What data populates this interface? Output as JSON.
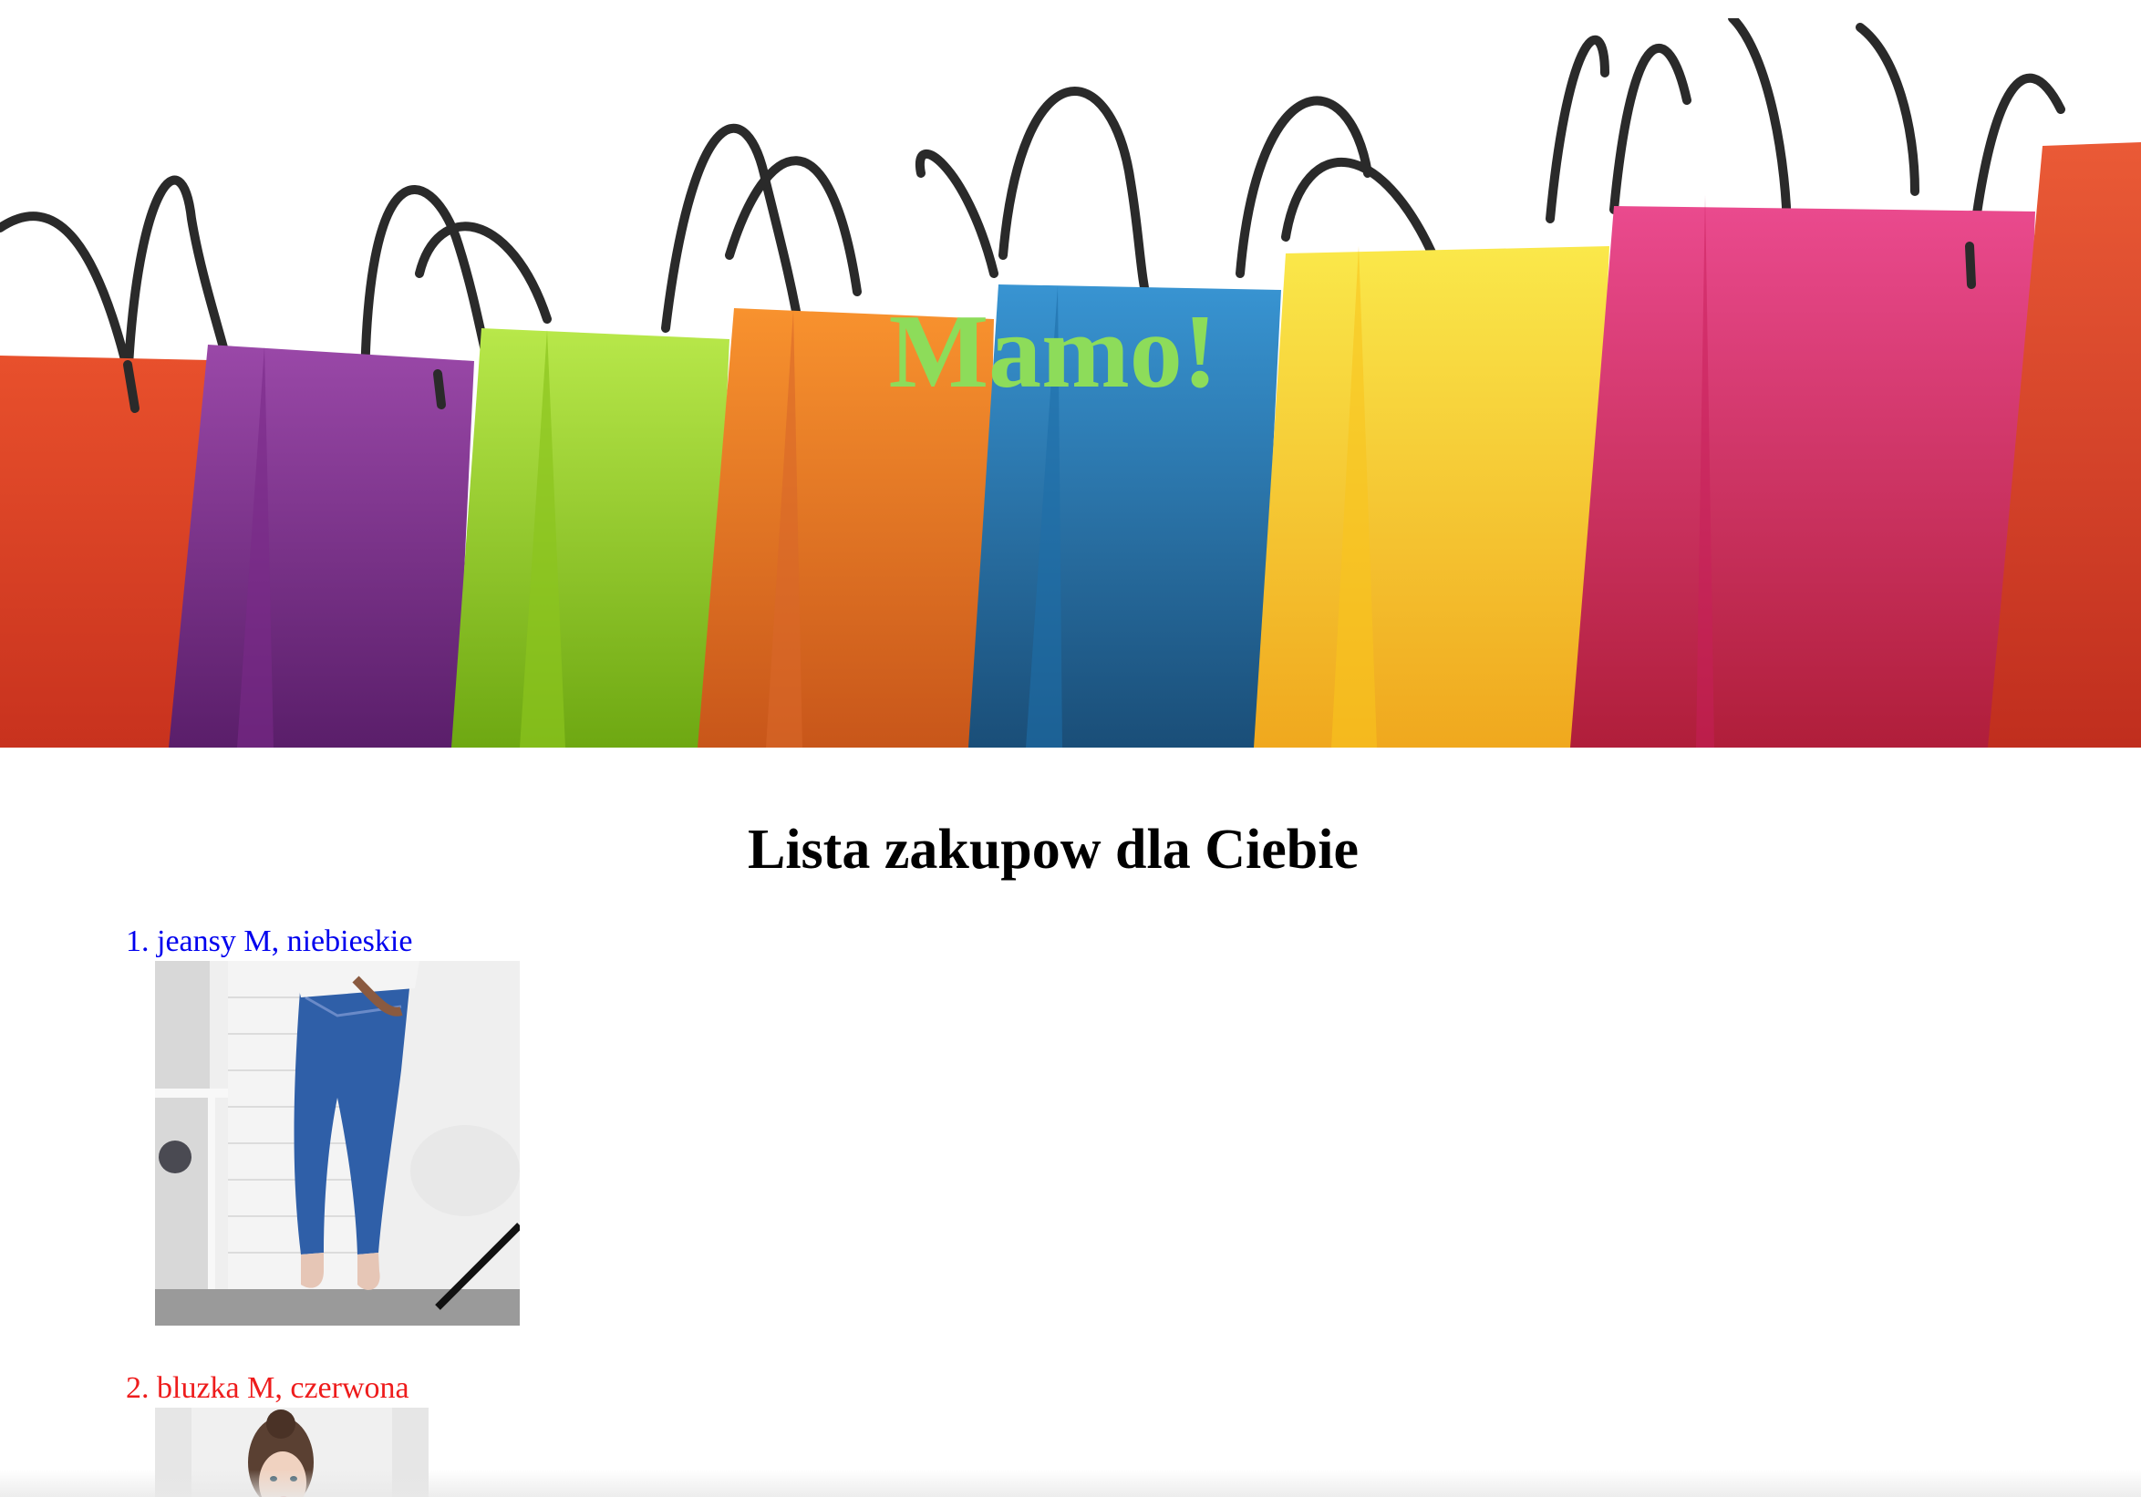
{
  "banner": {
    "title": "Mamo!",
    "title_color": "#8ddc5a",
    "image": "shopping-bags-image",
    "bag_colors": [
      "#e84a2a",
      "#8e3aa0",
      "#a5dc2e",
      "#f0862a",
      "#2f8ac8",
      "#f5d21e",
      "#e63c78",
      "#e65a36"
    ]
  },
  "heading": "Lista zakupow dla Ciebie",
  "items": [
    {
      "label": "1. jeansy M, niebieskie",
      "color": "#0000ee",
      "image": "jeans-photo"
    },
    {
      "label": "2. bluzka M, czerwona",
      "color": "#ee1c1c",
      "image": "blouse-photo"
    }
  ]
}
